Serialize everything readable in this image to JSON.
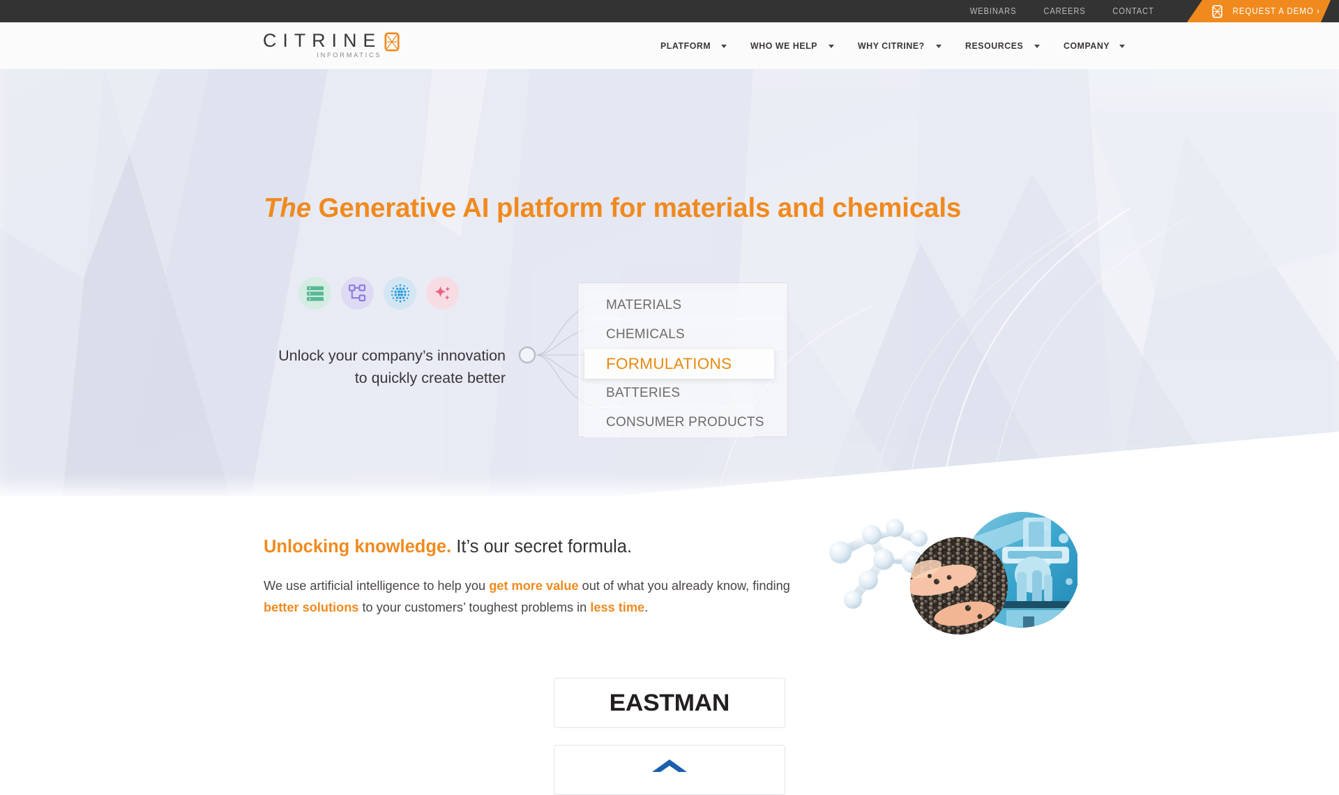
{
  "brand": {
    "accent": "#F08A1E",
    "dark": "#333333",
    "logo_name": "CITRINE",
    "logo_tagline": "INFORMATICS",
    "logo_mark_icon": "citrine-cube-icon"
  },
  "topbar": {
    "links": [
      {
        "label": "WEBINARS",
        "name": "topbar-link-webinars"
      },
      {
        "label": "CAREERS",
        "name": "topbar-link-careers"
      },
      {
        "label": "CONTACT",
        "name": "topbar-link-contact"
      }
    ],
    "cta": {
      "label": "REQUEST A DEMO ›",
      "icon": "citrine-cube-icon",
      "bg": "#F08A1E"
    }
  },
  "nav": {
    "items": [
      {
        "label": "PLATFORM",
        "has_dropdown": true
      },
      {
        "label": "WHO WE HELP",
        "has_dropdown": true
      },
      {
        "label": "WHY CITRINE?",
        "has_dropdown": true
      },
      {
        "label": "RESOURCES",
        "has_dropdown": true
      },
      {
        "label": "COMPANY",
        "has_dropdown": true
      }
    ],
    "caret_icon": "chevron-down-icon"
  },
  "hero": {
    "headline_emphasis": "The",
    "headline_rest": " Generative AI platform for materials and chemicals",
    "headline_color": "#F08A1E",
    "tagline_line1": "Unlock your company’s innovation",
    "tagline_line2": "to quickly create better",
    "feature_icons": [
      {
        "name": "database-icon",
        "bg": "#d4ece1",
        "fg": "#5cb894"
      },
      {
        "name": "workflow-nodes-icon",
        "bg": "#dedaf3",
        "fg": "#8b7ddc"
      },
      {
        "name": "dot-grid-icon",
        "bg": "#d4e6f3",
        "fg": "#2a9bdc"
      },
      {
        "name": "sparkles-icon",
        "bg": "#f7dde3",
        "fg": "#ef5f83"
      }
    ],
    "node_icon": "connector-node-icon",
    "categories": [
      {
        "label": "MATERIALS",
        "active": false
      },
      {
        "label": "CHEMICALS",
        "active": false
      },
      {
        "label": "FORMULATIONS",
        "active": true
      },
      {
        "label": "BATTERIES",
        "active": false
      },
      {
        "label": "CONSUMER PRODUCTS",
        "active": false
      }
    ]
  },
  "section2": {
    "heading_orange": "Unlocking knowledge.",
    "heading_dark": " It’s our secret formula.",
    "body_parts": [
      {
        "text": "We use artificial intelligence to help you ",
        "bold": false
      },
      {
        "text": "get more value",
        "bold": true
      },
      {
        "text": " out of what you already know, finding ",
        "bold": false
      },
      {
        "text": "better solutions",
        "bold": true
      },
      {
        "text": " to your customers’ toughest problems in ",
        "bold": false
      },
      {
        "text": "less time",
        "bold": true
      },
      {
        "text": ".",
        "bold": false
      }
    ],
    "collage_alt": "molecule-pellets-microscope-collage"
  },
  "logos": {
    "cards": [
      {
        "label": "EASTMAN",
        "name": "logo-card-eastman"
      },
      {
        "label": "",
        "name": "logo-card-partial"
      }
    ]
  }
}
